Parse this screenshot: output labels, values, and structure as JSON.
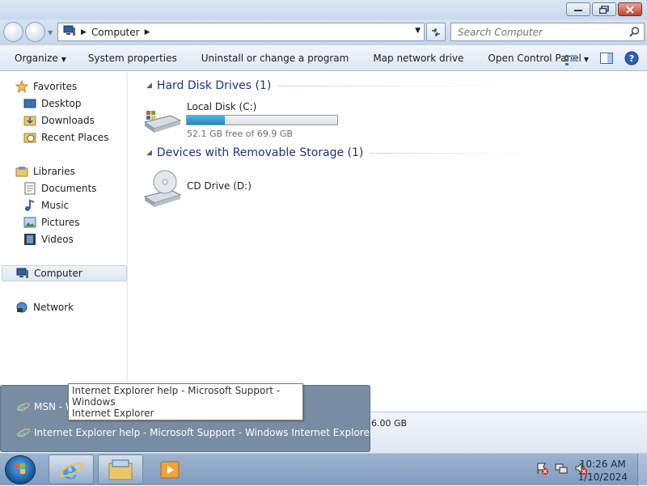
{
  "window": {
    "address": {
      "crumb": "Computer"
    },
    "search": {
      "placeholder": "Search Computer"
    }
  },
  "commandbar": {
    "organize": "Organize",
    "system_properties": "System properties",
    "uninstall": "Uninstall or change a program",
    "map_drive": "Map network drive",
    "control_panel": "Open Control Panel"
  },
  "navpane": {
    "favorites": "Favorites",
    "desktop": "Desktop",
    "downloads": "Downloads",
    "recent_places": "Recent Places",
    "libraries": "Libraries",
    "documents": "Documents",
    "music": "Music",
    "pictures": "Pictures",
    "videos": "Videos",
    "computer": "Computer",
    "network": "Network"
  },
  "content": {
    "hard_disks_group": "Hard Disk Drives (1)",
    "local_disk": {
      "name": "Local Disk (C:)",
      "free_text": "52.1 GB free of 69.9 GB",
      "used_fraction": 0.255
    },
    "removable_group": "Devices with Removable Storage (1)",
    "cd_drive": {
      "name": "CD Drive (D:)"
    }
  },
  "details": {
    "memory": "6.00 GB"
  },
  "jumplist": {
    "item1": "MSN - W",
    "item2": "Internet Explorer help - Microsoft Support - Windows Internet Explorer",
    "tooltip_line1": "Internet Explorer help - Microsoft Support - Windows",
    "tooltip_line2": "Internet Explorer"
  },
  "taskbar": {
    "clock_time": "10:26 AM",
    "clock_date": "1/10/2024"
  },
  "colors": {
    "accent": "#1e3287",
    "progress": "#2a9ad0",
    "taskbar": "#8ca6c7"
  }
}
